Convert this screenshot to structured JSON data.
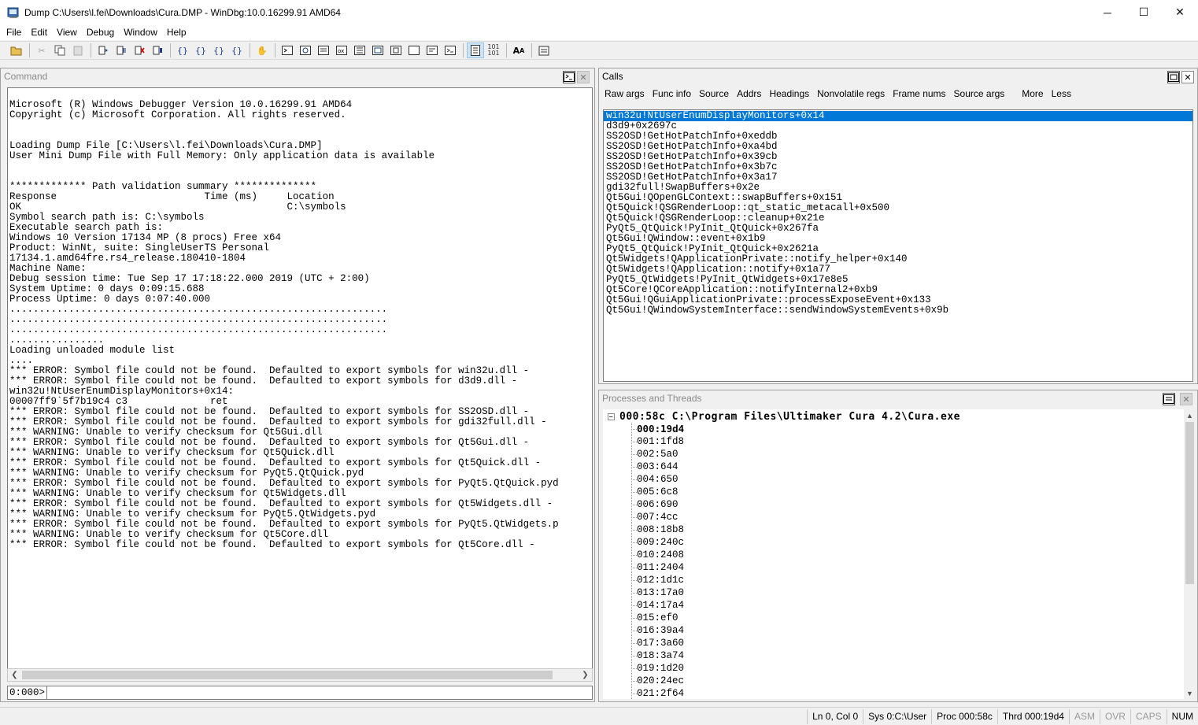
{
  "window": {
    "title": "Dump C:\\Users\\l.fei\\Downloads\\Cura.DMP - WinDbg:10.0.16299.91 AMD64",
    "minimize": "─",
    "maximize": "☐",
    "close": "✕"
  },
  "menu": [
    "File",
    "Edit",
    "View",
    "Debug",
    "Window",
    "Help"
  ],
  "toolbar": {
    "icons": [
      "open-icon",
      "cut-icon",
      "copy-icon",
      "paste-icon",
      "go-icon",
      "restart-icon",
      "stop-debugging-icon",
      "break-icon",
      "step-into-icon",
      "step-over-icon",
      "step-out-icon",
      "run-to-cursor-icon",
      "breakpoint-icon",
      "command-icon",
      "watch-icon",
      "locals-icon",
      "registers-icon",
      "memory-icon",
      "call-stack-icon",
      "disassembly-icon",
      "scratch-pad-icon",
      "source-mode-icon",
      "hex-mode-icon",
      "font-icon",
      "options-icon"
    ]
  },
  "command_panel": {
    "title": "Command",
    "prompt": "0:000>",
    "input_value": "",
    "output": [
      "Microsoft (R) Windows Debugger Version 10.0.16299.91 AMD64",
      "Copyright (c) Microsoft Corporation. All rights reserved.",
      "",
      "",
      "Loading Dump File [C:\\Users\\l.fei\\Downloads\\Cura.DMP]",
      "User Mini Dump File with Full Memory: Only application data is available",
      "",
      "",
      "************* Path validation summary **************",
      "Response                         Time (ms)     Location",
      "OK                                             C:\\symbols",
      "Symbol search path is: C:\\symbols",
      "Executable search path is:",
      "Windows 10 Version 17134 MP (8 procs) Free x64",
      "Product: WinNt, suite: SingleUserTS Personal",
      "17134.1.amd64fre.rs4_release.180410-1804",
      "Machine Name:",
      "Debug session time: Tue Sep 17 17:18:22.000 2019 (UTC + 2:00)",
      "System Uptime: 0 days 0:09:15.688",
      "Process Uptime: 0 days 0:07:40.000",
      "................................................................",
      "................................................................",
      "................................................................",
      "................",
      "Loading unloaded module list",
      "....",
      "*** ERROR: Symbol file could not be found.  Defaulted to export symbols for win32u.dll -",
      "*** ERROR: Symbol file could not be found.  Defaulted to export symbols for d3d9.dll -",
      "win32u!NtUserEnumDisplayMonitors+0x14:",
      "00007ff9`5f7b19c4 c3              ret",
      "*** ERROR: Symbol file could not be found.  Defaulted to export symbols for SS2OSD.dll -",
      "*** ERROR: Symbol file could not be found.  Defaulted to export symbols for gdi32full.dll -",
      "*** WARNING: Unable to verify checksum for Qt5Gui.dll",
      "*** ERROR: Symbol file could not be found.  Defaulted to export symbols for Qt5Gui.dll -",
      "*** WARNING: Unable to verify checksum for Qt5Quick.dll",
      "*** ERROR: Symbol file could not be found.  Defaulted to export symbols for Qt5Quick.dll -",
      "*** WARNING: Unable to verify checksum for PyQt5.QtQuick.pyd",
      "*** ERROR: Symbol file could not be found.  Defaulted to export symbols for PyQt5.QtQuick.pyd",
      "*** WARNING: Unable to verify checksum for Qt5Widgets.dll",
      "*** ERROR: Symbol file could not be found.  Defaulted to export symbols for Qt5Widgets.dll -",
      "*** WARNING: Unable to verify checksum for PyQt5.QtWidgets.pyd",
      "*** ERROR: Symbol file could not be found.  Defaulted to export symbols for PyQt5.QtWidgets.p",
      "*** WARNING: Unable to verify checksum for Qt5Core.dll",
      "*** ERROR: Symbol file could not be found.  Defaulted to export symbols for Qt5Core.dll -"
    ]
  },
  "calls_panel": {
    "title": "Calls",
    "options": [
      "Raw args",
      "Func info",
      "Source",
      "Addrs",
      "Headings",
      "Nonvolatile regs",
      "Frame nums",
      "Source args",
      "More",
      "Less"
    ],
    "frames": [
      "win32u!NtUserEnumDisplayMonitors+0x14",
      "d3d9+0x2697c",
      "SS2OSD!GetHotPatchInfo+0xeddb",
      "SS2OSD!GetHotPatchInfo+0xa4bd",
      "SS2OSD!GetHotPatchInfo+0x39cb",
      "SS2OSD!GetHotPatchInfo+0x3b7c",
      "SS2OSD!GetHotPatchInfo+0x3a17",
      "gdi32full!SwapBuffers+0x2e",
      "Qt5Gui!QOpenGLContext::swapBuffers+0x151",
      "Qt5Quick!QSGRenderLoop::qt_static_metacall+0x500",
      "Qt5Quick!QSGRenderLoop::cleanup+0x21e",
      "PyQt5_QtQuick!PyInit_QtQuick+0x267fa",
      "Qt5Gui!QWindow::event+0x1b9",
      "PyQt5_QtQuick!PyInit_QtQuick+0x2621a",
      "Qt5Widgets!QApplicationPrivate::notify_helper+0x140",
      "Qt5Widgets!QApplication::notify+0x1a77",
      "PyQt5_QtWidgets!PyInit_QtWidgets+0x17e8e5",
      "Qt5Core!QCoreApplication::notifyInternal2+0xb9",
      "Qt5Gui!QGuiApplicationPrivate::processExposeEvent+0x133",
      "Qt5Gui!QWindowSystemInterface::sendWindowSystemEvents+0x9b"
    ]
  },
  "processes_panel": {
    "title": "Processes and Threads",
    "process": "000:58c C:\\Program Files\\Ultimaker Cura 4.2\\Cura.exe",
    "threads": [
      "000:19d4",
      "001:1fd8",
      "002:5a0",
      "003:644",
      "004:650",
      "005:6c8",
      "006:690",
      "007:4cc",
      "008:18b8",
      "009:240c",
      "010:2408",
      "011:2404",
      "012:1d1c",
      "013:17a0",
      "014:17a4",
      "015:ef0",
      "016:39a4",
      "017:3a60",
      "018:3a74",
      "019:1d20",
      "020:24ec",
      "021:2f64"
    ]
  },
  "statusbar": {
    "position": "Ln 0, Col 0",
    "sys": "Sys 0:C:\\User",
    "proc": "Proc 000:58c",
    "thrd": "Thrd 000:19d4",
    "asm": "ASM",
    "ovr": "OVR",
    "caps": "CAPS",
    "num": "NUM"
  }
}
